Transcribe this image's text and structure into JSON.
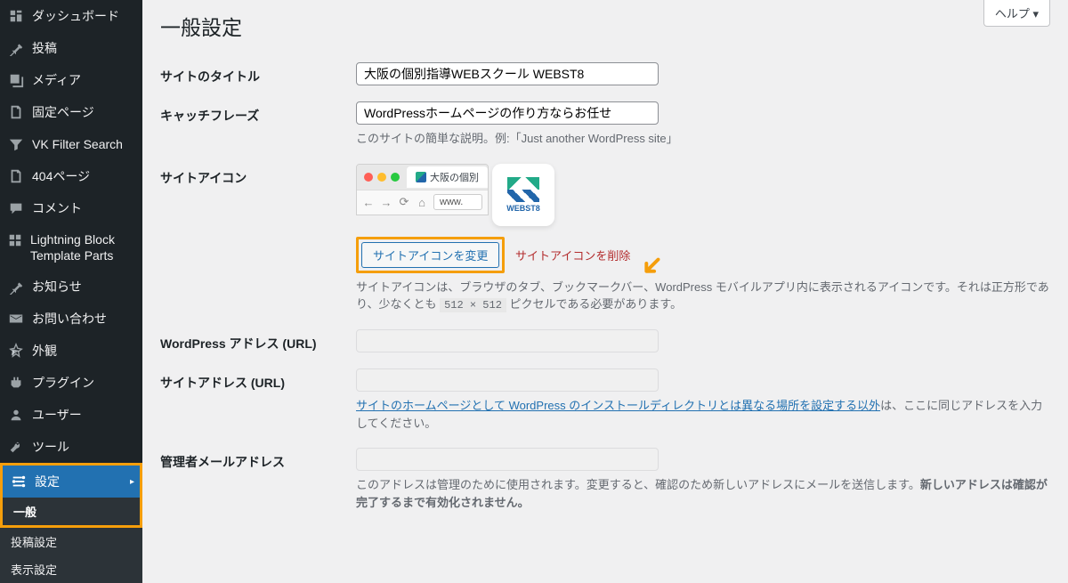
{
  "sidebar": {
    "items": [
      {
        "label": "ダッシュボード",
        "icon": "dashboard"
      },
      {
        "label": "投稿",
        "icon": "pin"
      },
      {
        "label": "メディア",
        "icon": "media"
      },
      {
        "label": "固定ページ",
        "icon": "page"
      },
      {
        "label": "VK Filter Search",
        "icon": "filter"
      },
      {
        "label": "404ページ",
        "icon": "page"
      },
      {
        "label": "コメント",
        "icon": "comment"
      },
      {
        "label": "Lightning Block Template Parts",
        "icon": "block"
      },
      {
        "label": "お知らせ",
        "icon": "pin"
      },
      {
        "label": "お問い合わせ",
        "icon": "mail"
      },
      {
        "label": "外観",
        "icon": "appearance"
      },
      {
        "label": "プラグイン",
        "icon": "plugin"
      },
      {
        "label": "ユーザー",
        "icon": "user"
      },
      {
        "label": "ツール",
        "icon": "tools"
      },
      {
        "label": "設定",
        "icon": "settings",
        "current": true
      }
    ],
    "submenu": [
      {
        "label": "一般",
        "current": true
      },
      {
        "label": "投稿設定"
      },
      {
        "label": "表示設定"
      }
    ]
  },
  "help_label": "ヘルプ ▾",
  "page_title": "一般設定",
  "fields": {
    "site_title": {
      "label": "サイトのタイトル",
      "value": "大阪の個別指導WEBスクール WEBST8"
    },
    "tagline": {
      "label": "キャッチフレーズ",
      "value": "WordPressホームページの作り方ならお任せ",
      "desc": "このサイトの簡単な説明。例:「Just another WordPress site」"
    },
    "site_icon": {
      "label": "サイトアイコン",
      "tab_title": "大阪の個別",
      "url_text": "www.",
      "favicon_brand": "WEBST8",
      "change_btn": "サイトアイコンを変更",
      "remove_link": "サイトアイコンを削除",
      "desc_pre": "サイトアイコンは、ブラウザのタブ、ブックマークバー、WordPress モバイルアプリ内に表示されるアイコンです。それは正方形であり、少なくとも ",
      "dims": "512 × 512",
      "desc_post": " ピクセルである必要があります。"
    },
    "wp_url": {
      "label": "WordPress アドレス (URL)"
    },
    "site_url": {
      "label": "サイトアドレス (URL)",
      "link_text": "サイトのホームページとして WordPress のインストールディレクトリとは異なる場所を設定する以外",
      "desc_post": "は、ここに同じアドレスを入力してください。"
    },
    "admin_email": {
      "label": "管理者メールアドレス",
      "desc_pre": "このアドレスは管理のために使用されます。変更すると、確認のため新しいアドレスにメールを送信します。",
      "desc_bold": "新しいアドレスは確認が完了するまで有効化されません。"
    }
  }
}
